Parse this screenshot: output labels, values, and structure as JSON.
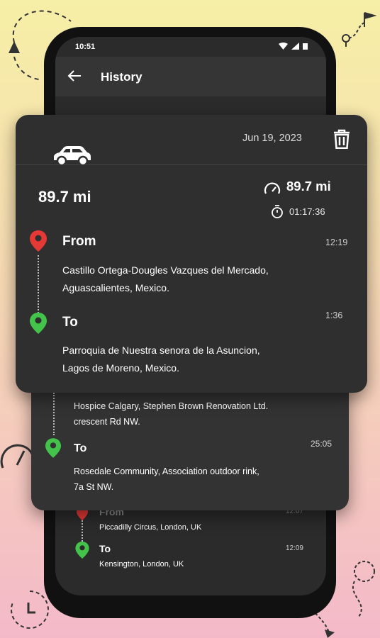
{
  "status_bar": {
    "time": "10:51"
  },
  "app_bar": {
    "title": "History"
  },
  "trip_card": {
    "date": "Jun 19, 2023",
    "distance": "89.7 mi",
    "odometer": "89.7 mi",
    "duration": "01:17:36",
    "from_label": "From",
    "from_time": "12:19",
    "from_address_1": "Castillo Ortega-Dougles Vazques del Mercado,",
    "from_address_2": "Aguascalientes, Mexico.",
    "to_label": "To",
    "to_time": "1:36",
    "to_address_1": "Parroquia de Nuestra senora de la Asuncion,",
    "to_address_2": "Lagos de Moreno, Mexico."
  },
  "second_card": {
    "from_address_1": "Hospice Calgary, Stephen Brown Renovation Ltd.",
    "from_address_2": "crescent Rd NW.",
    "to_label": "To",
    "to_time": "25:05",
    "to_address_1": "Rosedale Community, Association outdoor rink,",
    "to_address_2": "7a St NW."
  },
  "third_card": {
    "from_label": "From",
    "from_time": "12:07",
    "from_address": "Piccadilly Circus, London, UK",
    "to_label": "To",
    "to_time": "12:09",
    "to_address": "Kensington, London, UK"
  },
  "colors": {
    "pin_red": "#e53935",
    "pin_green": "#43c34a",
    "card": "#2f2f2f"
  }
}
